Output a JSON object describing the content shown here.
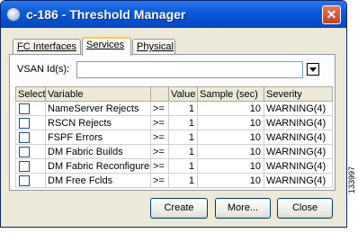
{
  "window": {
    "title": "c-186 - Threshold Manager",
    "close_glyph": "✕"
  },
  "tabs": [
    {
      "label": "FC Interfaces",
      "active": false
    },
    {
      "label": "Services",
      "active": true
    },
    {
      "label": "Physical",
      "active": false
    }
  ],
  "vsan": {
    "label": "VSAN Id(s):",
    "value": ""
  },
  "table": {
    "headers": [
      "Select",
      "Variable",
      "",
      "Value",
      "Sample (sec)",
      "Severity"
    ],
    "rows": [
      {
        "checked": false,
        "variable": "NameServer Rejects",
        "op": ">=",
        "value": "1",
        "sample": "10",
        "severity": "WARNING(4)"
      },
      {
        "checked": false,
        "variable": "RSCN Rejects",
        "op": ">=",
        "value": "1",
        "sample": "10",
        "severity": "WARNING(4)"
      },
      {
        "checked": false,
        "variable": "FSPF Errors",
        "op": ">=",
        "value": "1",
        "sample": "10",
        "severity": "WARNING(4)"
      },
      {
        "checked": false,
        "variable": "DM Fabric Builds",
        "op": ">=",
        "value": "1",
        "sample": "10",
        "severity": "WARNING(4)"
      },
      {
        "checked": false,
        "variable": "DM Fabric Reconfigures",
        "op": ">=",
        "value": "1",
        "sample": "10",
        "severity": "WARNING(4)"
      },
      {
        "checked": false,
        "variable": "DM Free Fclds",
        "op": ">=",
        "value": "1",
        "sample": "10",
        "severity": "WARNING(4)"
      }
    ]
  },
  "buttons": {
    "create": "Create",
    "more": "More...",
    "close": "Close"
  },
  "figure_id": "133997",
  "colors": {
    "title_bar": "#0a58d8",
    "dialog_bg": "#ece9d8",
    "tab_highlight": "#ffc83c"
  }
}
